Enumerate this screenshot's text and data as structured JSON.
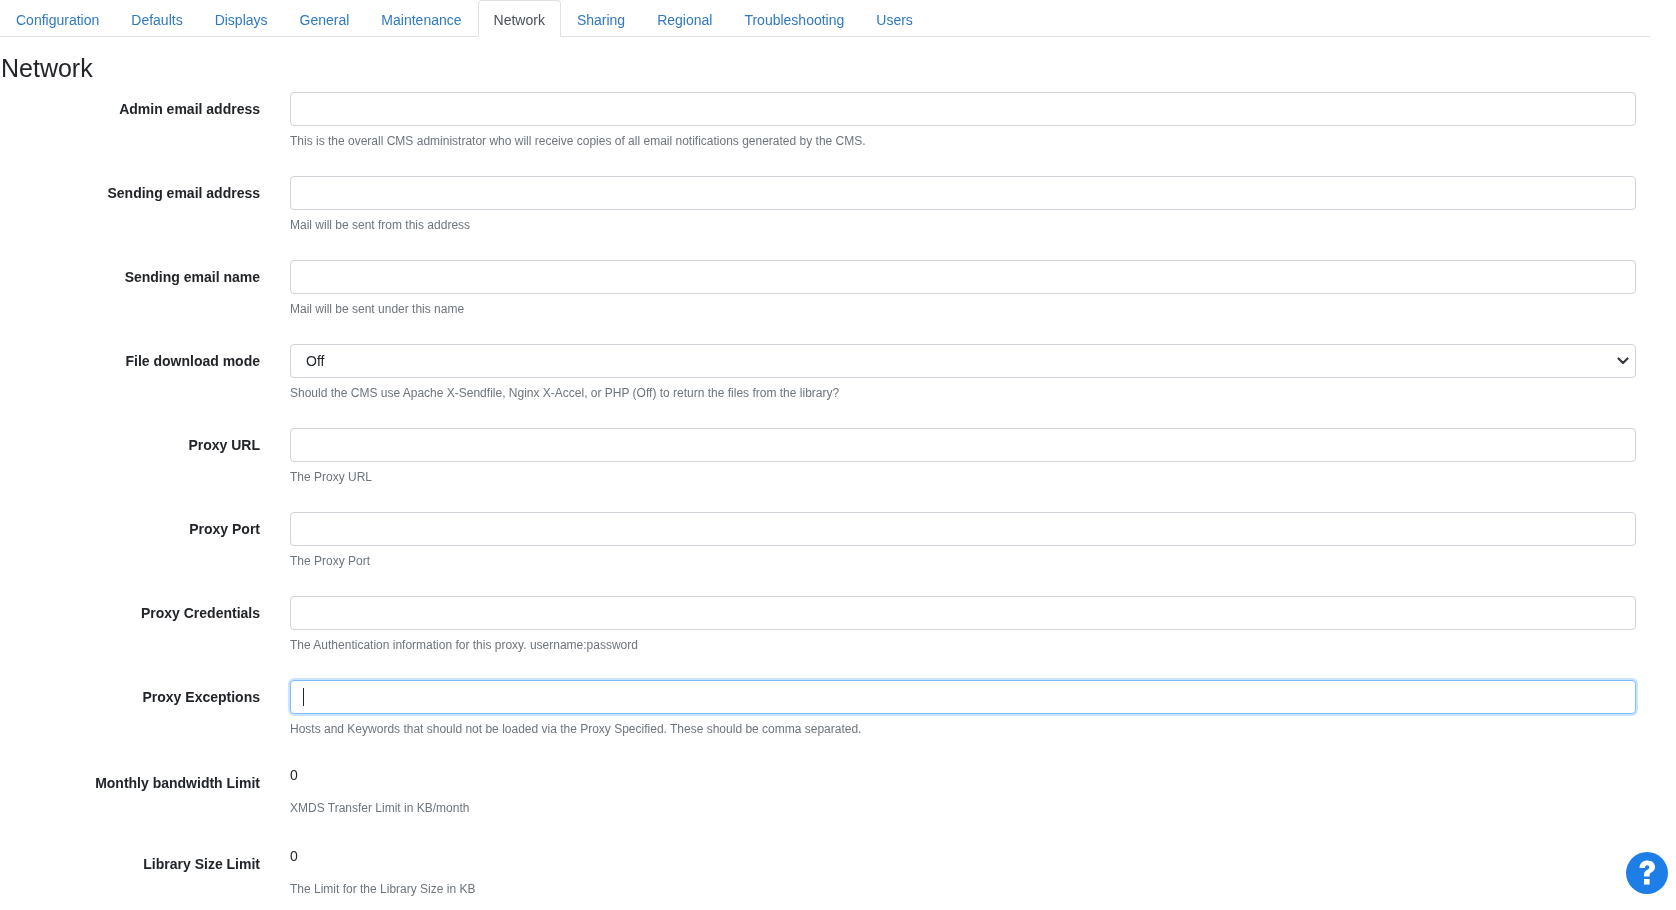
{
  "tabs": [
    {
      "label": "Configuration",
      "selected": false
    },
    {
      "label": "Defaults",
      "selected": false
    },
    {
      "label": "Displays",
      "selected": false
    },
    {
      "label": "General",
      "selected": false
    },
    {
      "label": "Maintenance",
      "selected": false
    },
    {
      "label": "Network",
      "selected": true
    },
    {
      "label": "Sharing",
      "selected": false
    },
    {
      "label": "Regional",
      "selected": false
    },
    {
      "label": "Troubleshooting",
      "selected": false
    },
    {
      "label": "Users",
      "selected": false
    }
  ],
  "heading": "Network",
  "fields": [
    {
      "kind": "text",
      "label": "Admin email address",
      "focused": false,
      "help": "This is the overall CMS administrator who will receive copies of all email notifications generated by the CMS."
    },
    {
      "kind": "text",
      "label": "Sending email address",
      "focused": false,
      "help": "Mail will be sent from this address"
    },
    {
      "kind": "text",
      "label": "Sending email name",
      "focused": false,
      "help": "Mail will be sent under this name"
    },
    {
      "kind": "select",
      "label": "File download mode",
      "value": "Off",
      "help": "Should the CMS use Apache X-Sendfile, Nginx X-Accel, or PHP (Off) to return the files from the library?"
    },
    {
      "kind": "text",
      "label": "Proxy URL",
      "focused": false,
      "help": "The Proxy URL"
    },
    {
      "kind": "text",
      "label": "Proxy Port",
      "focused": false,
      "help": "The Proxy Port"
    },
    {
      "kind": "text",
      "label": "Proxy Credentials",
      "focused": false,
      "help": "The Authentication information for this proxy. username:password"
    },
    {
      "kind": "text",
      "label": "Proxy Exceptions",
      "focused": true,
      "help": "Hosts and Keywords that should not be loaded via the Proxy Specified. These should be comma separated."
    },
    {
      "kind": "static",
      "label": "Monthly bandwidth Limit",
      "value": "0",
      "help": "XMDS Transfer Limit in KB/month"
    },
    {
      "kind": "static",
      "label": "Library Size Limit",
      "value": "0",
      "help": "The Limit for the Library Size in KB"
    }
  ]
}
